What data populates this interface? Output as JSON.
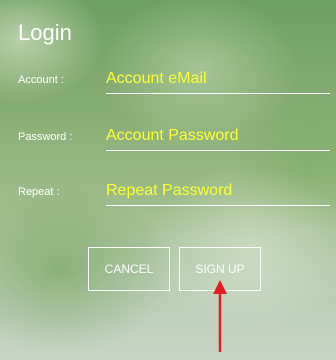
{
  "screen": {
    "title": "Login",
    "fields": {
      "account": {
        "label": "Account :",
        "placeholder": "Account eMail"
      },
      "password": {
        "label": "Password :",
        "placeholder": "Account Password"
      },
      "repeat": {
        "label": "Repeat :",
        "placeholder": "Repeat Password"
      }
    },
    "buttons": {
      "cancel": "CANCEL",
      "signup": "SIGN UP"
    }
  },
  "colors": {
    "input_text": "#ffff33",
    "label_text": "#ffffff",
    "annotation_arrow": "#e02020"
  }
}
